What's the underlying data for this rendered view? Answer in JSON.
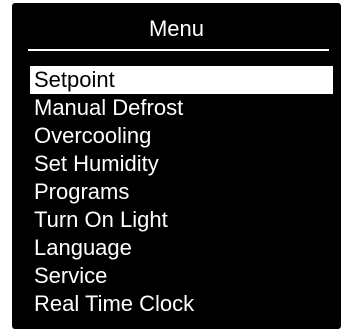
{
  "menu": {
    "title": "Menu",
    "items": [
      {
        "label": "Setpoint",
        "selected": true
      },
      {
        "label": "Manual Defrost",
        "selected": false
      },
      {
        "label": "Overcooling",
        "selected": false
      },
      {
        "label": "Set Humidity",
        "selected": false
      },
      {
        "label": "Programs",
        "selected": false
      },
      {
        "label": "Turn On Light",
        "selected": false
      },
      {
        "label": "Language",
        "selected": false
      },
      {
        "label": "Service",
        "selected": false
      },
      {
        "label": "Real Time Clock",
        "selected": false
      }
    ]
  },
  "colors": {
    "screen_background": "#000000",
    "text": "#ffffff",
    "highlight_background": "#ffffff",
    "highlight_text": "#000000"
  }
}
